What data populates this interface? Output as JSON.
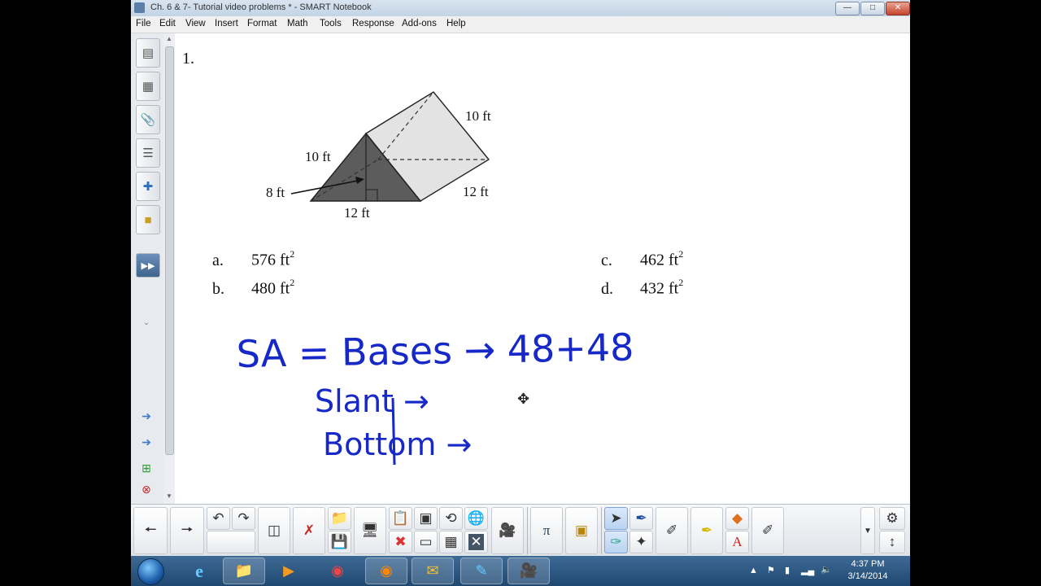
{
  "window": {
    "title": "Ch. 6 & 7- Tutorial video problems * - SMART Notebook"
  },
  "menu": [
    "File",
    "Edit",
    "View",
    "Insert",
    "Format",
    "Math",
    "Tools",
    "Response",
    "Add-ons",
    "Help"
  ],
  "question": {
    "number": "1.",
    "labels": {
      "slant_top": "10 ft",
      "slant_left": "10 ft",
      "height": "8 ft",
      "base": "12 ft",
      "length": "12 ft"
    },
    "choices": [
      {
        "letter": "a.",
        "value": "576 ft",
        "exp": "2"
      },
      {
        "letter": "b.",
        "value": "480 ft",
        "exp": "2"
      },
      {
        "letter": "c.",
        "value": "462 ft",
        "exp": "2"
      },
      {
        "letter": "d.",
        "value": "432 ft",
        "exp": "2"
      }
    ]
  },
  "handwriting": {
    "line1": "SA = Bases → 48+48",
    "line2": "Slant →",
    "line3": "Bottom →",
    "ink_color": "#1628c8"
  },
  "toolbar": {
    "icons": [
      "back-icon",
      "forward-icon",
      "undo-icon",
      "redo-icon",
      "screen-shade-icon",
      "delete-icon",
      "open-icon",
      "save-icon",
      "display-icon",
      "paste-icon",
      "clear-page-icon",
      "insert-table-icon",
      "fullscreen-icon",
      "camera-icon",
      "math-icon",
      "response-icon",
      "select-icon",
      "pen-icon",
      "creative-pen-icon",
      "magic-pen-icon",
      "highlighter-icon",
      "eraser-icon",
      "shapes-icon",
      "text-icon",
      "fill-icon",
      "properties-icon"
    ]
  },
  "taskbar": {
    "apps": [
      "internet-explorer-icon",
      "file-explorer-icon",
      "media-player-icon",
      "chrome-icon",
      "firefox-icon",
      "outlook-icon",
      "smart-notebook-icon",
      "video-recorder-icon"
    ],
    "clock_time": "4:37 PM",
    "clock_date": "3/14/2014"
  }
}
